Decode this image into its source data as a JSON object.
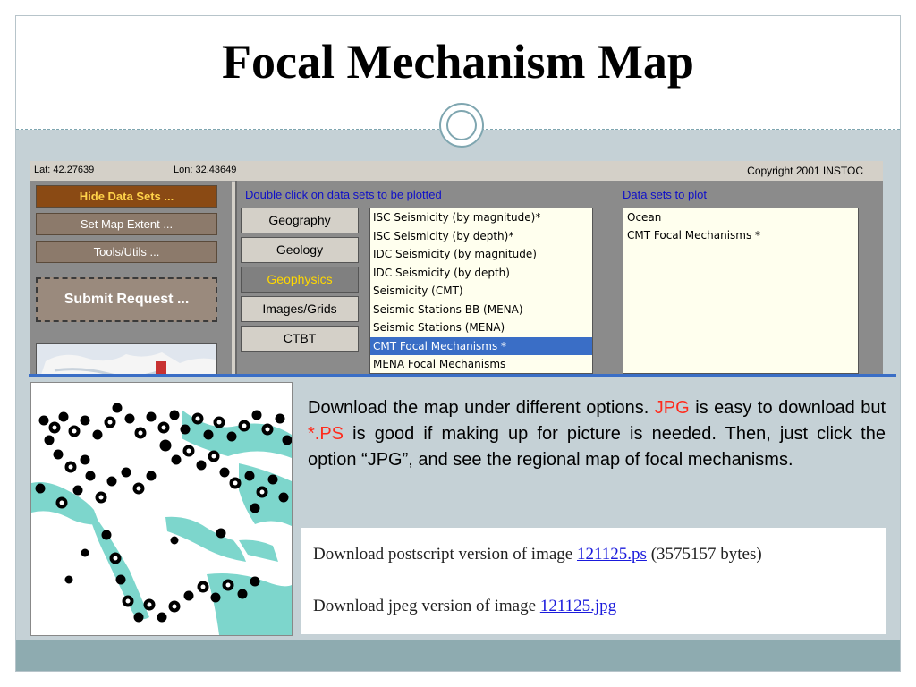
{
  "slide": {
    "title": "Focal Mechanism Map",
    "description_lead": "Download the map under different options.",
    "jpg_text": "JPG",
    "description_mid": "is easy to download but",
    "ps_text": "*.PS",
    "description_tail": "is good if making up for picture is needed. Then, just click the option “JPG”, and see the regional map of focal mechanisms.",
    "accent_color": "#ff2b1c"
  },
  "app": {
    "lat": "Lat: 42.27639",
    "lon": "Lon: 32.43649",
    "copyright": "Copyright 2001  INSTOC",
    "left_buttons": {
      "hide": "Hide Data Sets ...",
      "extent": "Set Map Extent ...",
      "tools": "Tools/Utils ...",
      "submit": "Submit Request ..."
    },
    "double_click_header": "Double click on data sets to be plotted",
    "plot_header": "Data sets to plot",
    "categories": [
      "Geography",
      "Geology",
      "Geophysics",
      "Images/Grids",
      "CTBT"
    ],
    "active_category": "Geophysics",
    "datasets": [
      "ISC Seismicity (by magnitude)*",
      "ISC Seismicity (by depth)*",
      "IDC Seismicity (by magnitude)",
      "IDC Seismicity (by depth)",
      "Seismicity (CMT)",
      "Seismic Stations BB (MENA)",
      "Seismic Stations (MENA)",
      "CMT Focal Mechanisms *",
      "MENA Focal Mechanisms"
    ],
    "selected_dataset": "CMT Focal Mechanisms *",
    "plot_items": [
      "Ocean",
      "CMT Focal Mechanisms *"
    ]
  },
  "downloads": {
    "ps_prefix": "Download postscript version of image",
    "ps_link": "121125.ps",
    "ps_suffix": "(3575157 bytes)",
    "jpg_prefix": "Download jpeg version of image",
    "jpg_link": "121125.jpg"
  }
}
